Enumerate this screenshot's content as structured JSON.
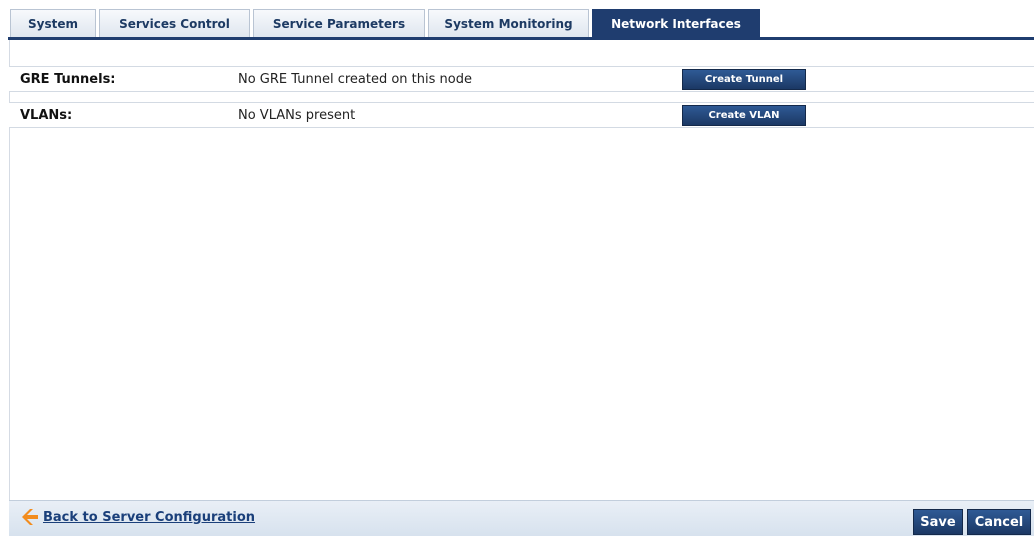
{
  "tabs": [
    {
      "label": "System"
    },
    {
      "label": "Services Control"
    },
    {
      "label": "Service Parameters"
    },
    {
      "label": "System Monitoring"
    },
    {
      "label": "Network Interfaces"
    }
  ],
  "active_tab": "Network Interfaces",
  "gre": {
    "label": "GRE Tunnels:",
    "value": "No GRE Tunnel created on this node",
    "button": "Create Tunnel"
  },
  "vlan": {
    "label": "VLANs:",
    "value": "No VLANs present",
    "button": "Create VLAN"
  },
  "footer": {
    "back_label": "Back to Server Configuration",
    "save_label": "Save",
    "cancel_label": "Cancel"
  },
  "colors": {
    "accent": "#1f3d6f",
    "back_arrow": "#f28c1e"
  },
  "icons": {
    "back": "back-arrow-icon"
  }
}
